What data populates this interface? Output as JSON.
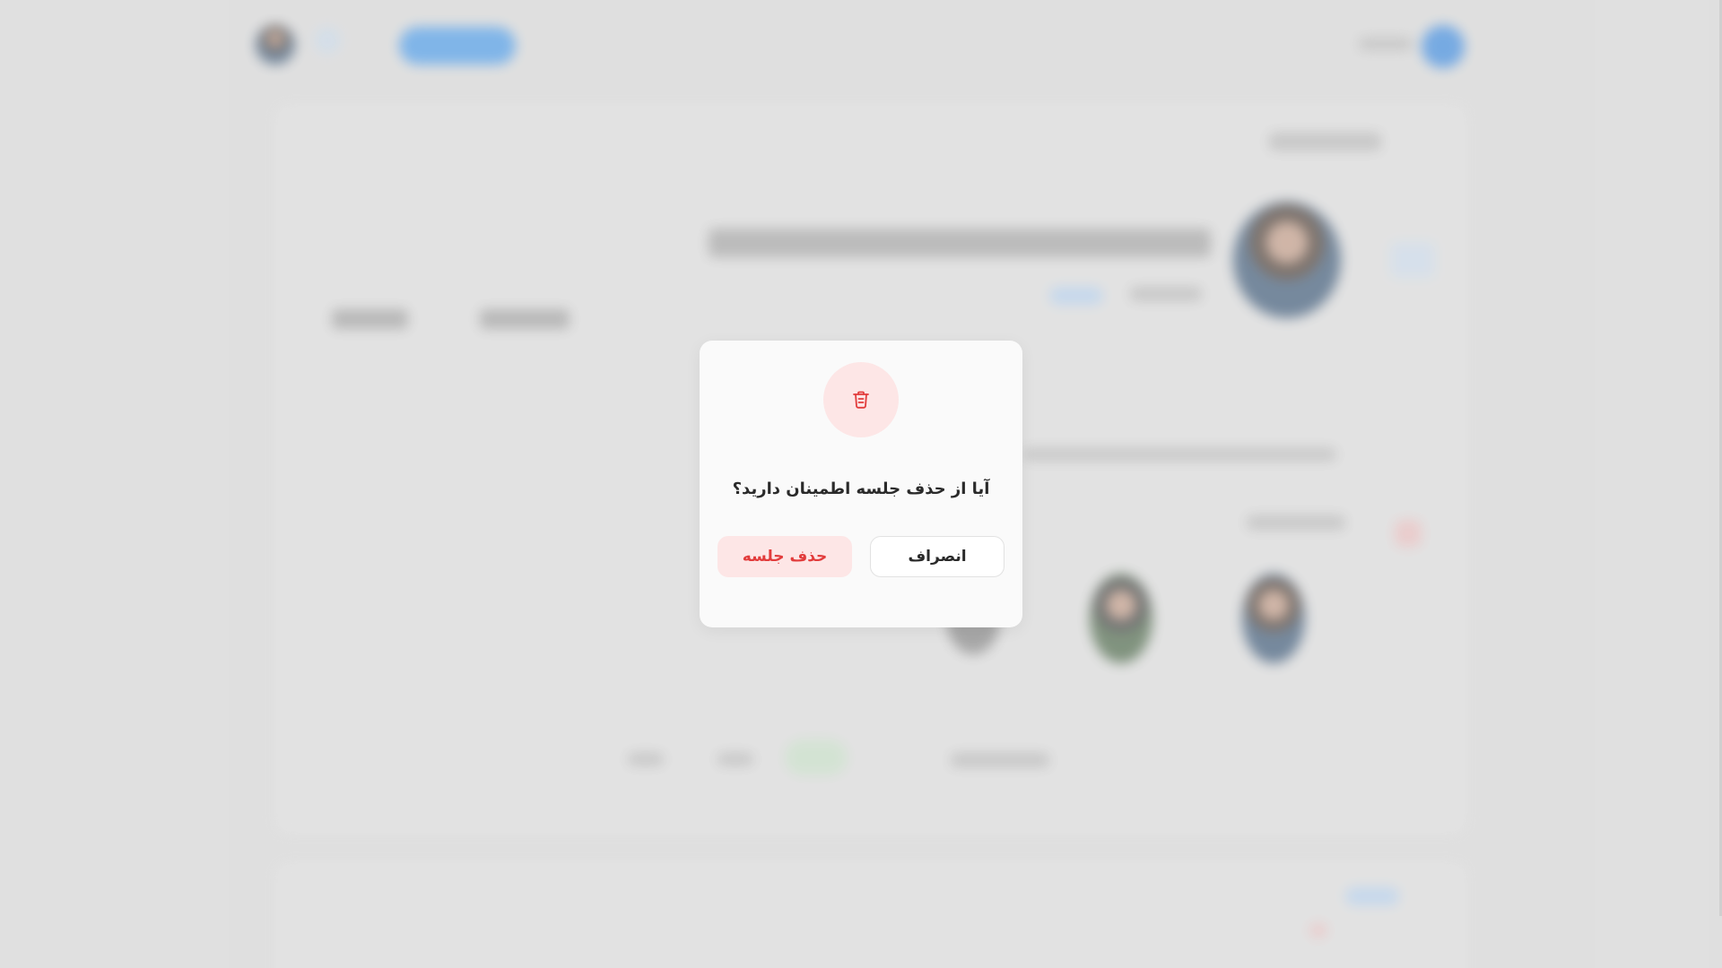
{
  "dialog": {
    "icon": "trash-icon",
    "question": "آیا از حذف جلسه اطمینان دارید؟",
    "cancel_label": "انصراف",
    "delete_label": "حذف جلسه"
  },
  "colors": {
    "danger": "#e23c3c",
    "danger_bg": "#fde6e6",
    "primary": "#3d8ee6",
    "backdrop": "#e1e1e1"
  }
}
